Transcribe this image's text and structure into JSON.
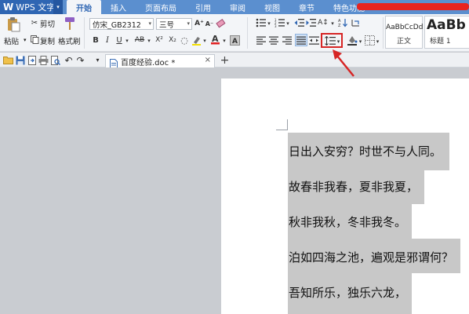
{
  "app": {
    "title": "WPS 文字",
    "logo": "W",
    "dropdown": "▾"
  },
  "tabs": [
    {
      "label": "开始",
      "active": true
    },
    {
      "label": "插入",
      "active": false
    },
    {
      "label": "页面布局",
      "active": false
    },
    {
      "label": "引用",
      "active": false
    },
    {
      "label": "审阅",
      "active": false
    },
    {
      "label": "视图",
      "active": false
    },
    {
      "label": "章节",
      "active": false
    },
    {
      "label": "特色功能",
      "active": false
    }
  ],
  "clipboard": {
    "paste": "粘贴",
    "cut": "剪切",
    "copy": "复制",
    "format_painter": "格式刷"
  },
  "font": {
    "name": "仿宋_GB2312",
    "size": "三号"
  },
  "styles": [
    {
      "sample": "AaBbCcDd",
      "name": "正文"
    },
    {
      "sample": "AaBb",
      "name": "标题 1"
    }
  ],
  "document": {
    "tab_label": "百度经验.doc *",
    "close": "×",
    "new_tab": "+",
    "lines": [
      "日出入安穷？时世不与人同。",
      "故春非我春，夏非我夏，",
      "秋非我秋，冬非我冬。",
      "泊如四海之池，遍观是邪谓何？",
      "吾知所乐，独乐六龙，"
    ]
  },
  "colors": {
    "accent": "#2f66b3",
    "annotation": "#d62525",
    "selection": "#c8c8c8"
  }
}
